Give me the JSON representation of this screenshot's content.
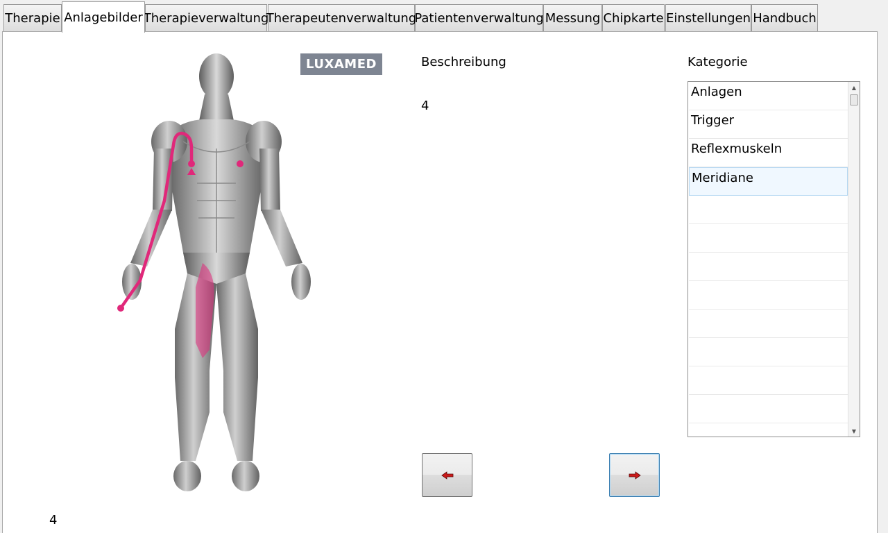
{
  "tabs": [
    {
      "label": "Therapie"
    },
    {
      "label": "Anlagebilder"
    },
    {
      "label": "Therapieverwaltung"
    },
    {
      "label": "Therapeutenverwaltung"
    },
    {
      "label": "Patientenverwaltung"
    },
    {
      "label": "Messung"
    },
    {
      "label": "Chipkarte"
    },
    {
      "label": "Einstellungen"
    },
    {
      "label": "Handbuch"
    }
  ],
  "active_tab": "Anlagebilder",
  "logo": {
    "text": "LUXAMED",
    "color": "#7e8592"
  },
  "image_number": "4",
  "description": {
    "label": "Beschreibung",
    "value": "4"
  },
  "category": {
    "label": "Kategorie",
    "items": [
      "Anlagen",
      "Trigger",
      "Reflexmuskeln",
      "Meridiane"
    ],
    "selected": "Meridiane"
  },
  "navigation": {
    "prev_icon": "arrow-left-icon",
    "next_icon": "arrow-right-icon",
    "arrow_color": "#cc1a1a"
  },
  "accent_color": "#e0287a"
}
